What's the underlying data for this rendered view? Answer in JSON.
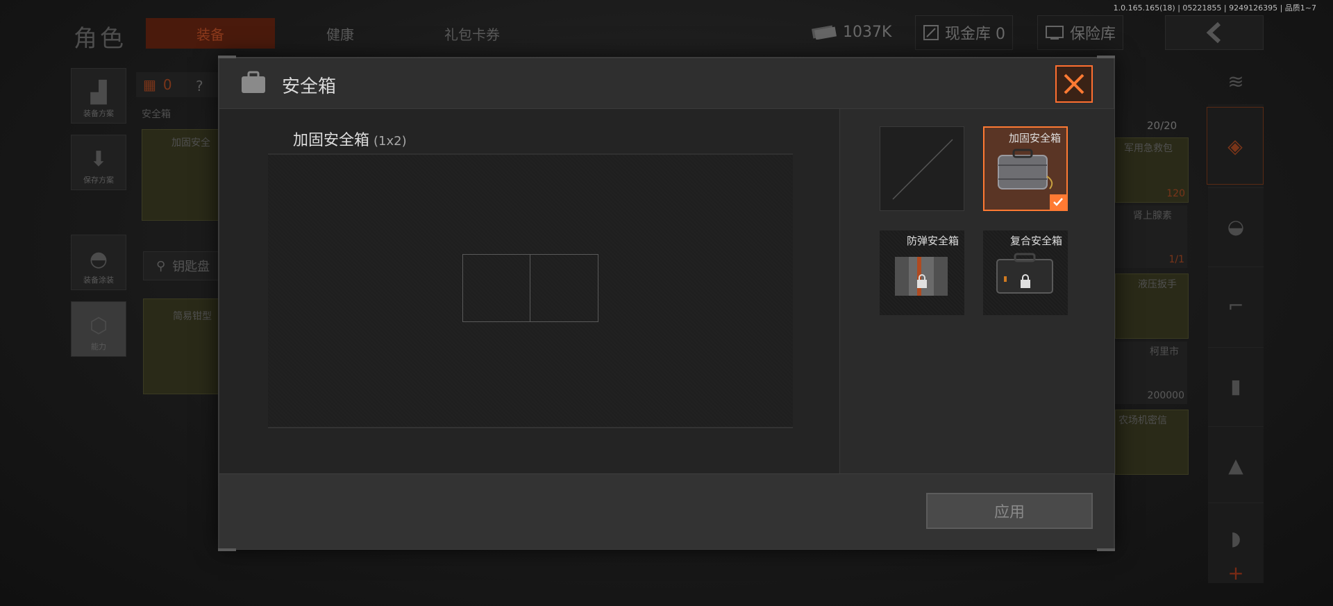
{
  "version": "1.0.165.165(18) | 05221855 | 9249126395 | 品质1~7",
  "header": {
    "page_title": "角色",
    "tabs": [
      {
        "label": "装备",
        "active": true
      },
      {
        "label": "健康",
        "active": false
      },
      {
        "label": "礼包卡券",
        "active": false
      }
    ],
    "currency": "1037K",
    "cash_vault": "现金库 0",
    "insurance": "保险库"
  },
  "left_tools": [
    {
      "label": "装备方案",
      "icon": "vest-icon"
    },
    {
      "label": "保存方案",
      "icon": "download-icon"
    },
    {
      "label": "装备涂装",
      "icon": "helmet-icon"
    },
    {
      "label": "能力",
      "icon": "lightning-icon"
    }
  ],
  "background": {
    "armor_count": "0",
    "help": "?",
    "section_label": "安全箱",
    "case_label": "加固安全",
    "keys_label": "钥匙盘",
    "tool_label": "简易钳型",
    "right_capacity": "20/20",
    "right_items": [
      {
        "label": "军用急救包",
        "value": "120"
      },
      {
        "label": "肾上腺素",
        "value": "1/1"
      },
      {
        "label": "液压扳手",
        "value": ""
      },
      {
        "label": "柯里市",
        "value": "200000"
      },
      {
        "label": "农场机密信",
        "value": ""
      }
    ]
  },
  "modal": {
    "title": "安全箱",
    "case_name": "加固安全箱",
    "case_size": "(1x2)",
    "options": [
      {
        "label": "",
        "state": "empty"
      },
      {
        "label": "加固安全箱",
        "state": "selected"
      },
      {
        "label": "防弹安全箱",
        "state": "locked"
      },
      {
        "label": "复合安全箱",
        "state": "locked"
      }
    ],
    "apply_label": "应用"
  },
  "colors": {
    "accent": "#ff7a33",
    "selected_bg": "#5a3525"
  }
}
